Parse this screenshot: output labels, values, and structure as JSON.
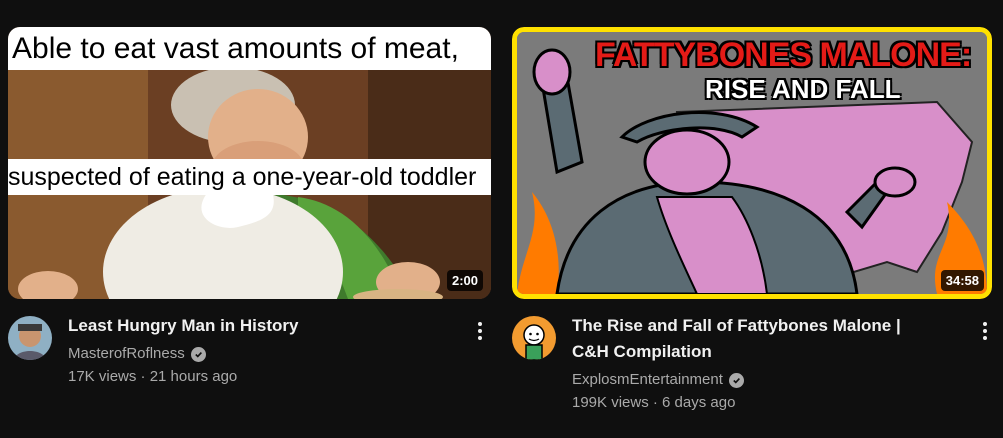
{
  "videos": [
    {
      "duration": "2:00",
      "thumb_caption_top": "Able to eat vast amounts of meat,",
      "thumb_caption_mid": "suspected of eating a one-year-old toddler",
      "title": "Least Hungry Man in History",
      "channel": "MasterofRoflness",
      "stats": "17K views · 21 hours ago"
    },
    {
      "duration": "34:58",
      "thumb_title_line1": "FATTYBONES MALONE:",
      "thumb_title_line2": "RISE AND FALL",
      "title": "The Rise and Fall of Fattybones Malone |\nC&H Compilation",
      "channel": "ExplosmEntertainment",
      "stats": "199K views · 6 days ago"
    }
  ],
  "colors": {
    "background": "#0f0f0f",
    "secondary_text": "#aaaaaa",
    "thumb_border": "#ffe100"
  }
}
